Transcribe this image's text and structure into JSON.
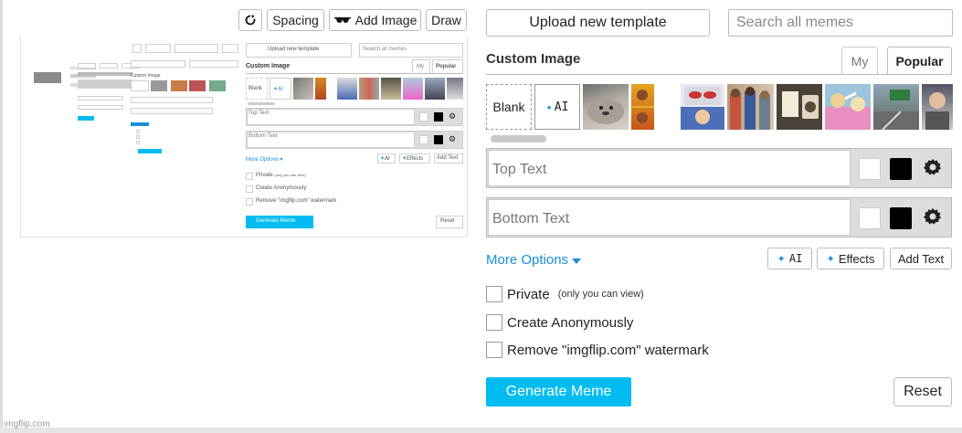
{
  "toolbar": {
    "rotate_icon": "rotate-icon",
    "spacing_label": "Spacing",
    "add_image_label": "Add Image",
    "draw_label": "Draw"
  },
  "preview": {
    "mini_upload": "Upload new template",
    "mini_search": "Search all memes",
    "mini_title": "Custom Image",
    "mini_tab_my": "My",
    "mini_tab_popular": "Popular",
    "mini_blank": "Blank",
    "mini_ai": "AI",
    "mini_top": "Top Text",
    "mini_bottom": "Bottom Text",
    "mini_more": "More Options",
    "mini_ai_btn": "AI",
    "mini_effects": "Effects",
    "mini_add_text": "Add Text",
    "mini_private": "Private",
    "mini_private_note": "(only you can view)",
    "mini_anon": "Create Anonymously",
    "mini_watermark": "Remove \"imgflip.com\" watermark",
    "mini_generate": "Generate Meme",
    "mini_reset": "Reset"
  },
  "header": {
    "upload_label": "Upload new template",
    "search_placeholder": "Search all memes"
  },
  "templates": {
    "title": "Custom Image",
    "tabs": {
      "my": "My",
      "popular": "Popular"
    },
    "blank_label": "Blank",
    "ai_label": "AI"
  },
  "text_boxes": [
    {
      "placeholder": "Top Text"
    },
    {
      "placeholder": "Bottom Text"
    }
  ],
  "options": {
    "more_options_label": "More Options",
    "ai_label": "AI",
    "effects_label": "Effects",
    "add_text_label": "Add Text"
  },
  "checkboxes": {
    "private_label": "Private",
    "private_note": "(only you can view)",
    "anonymous_label": "Create Anonymously",
    "watermark_label": "Remove \"imgflip.com\" watermark"
  },
  "actions": {
    "generate_label": "Generate Meme",
    "reset_label": "Reset"
  },
  "footer": {
    "watermark": "imgflip.com"
  },
  "colors": {
    "accent": "#00bcf0",
    "link": "#1a8fd9"
  }
}
